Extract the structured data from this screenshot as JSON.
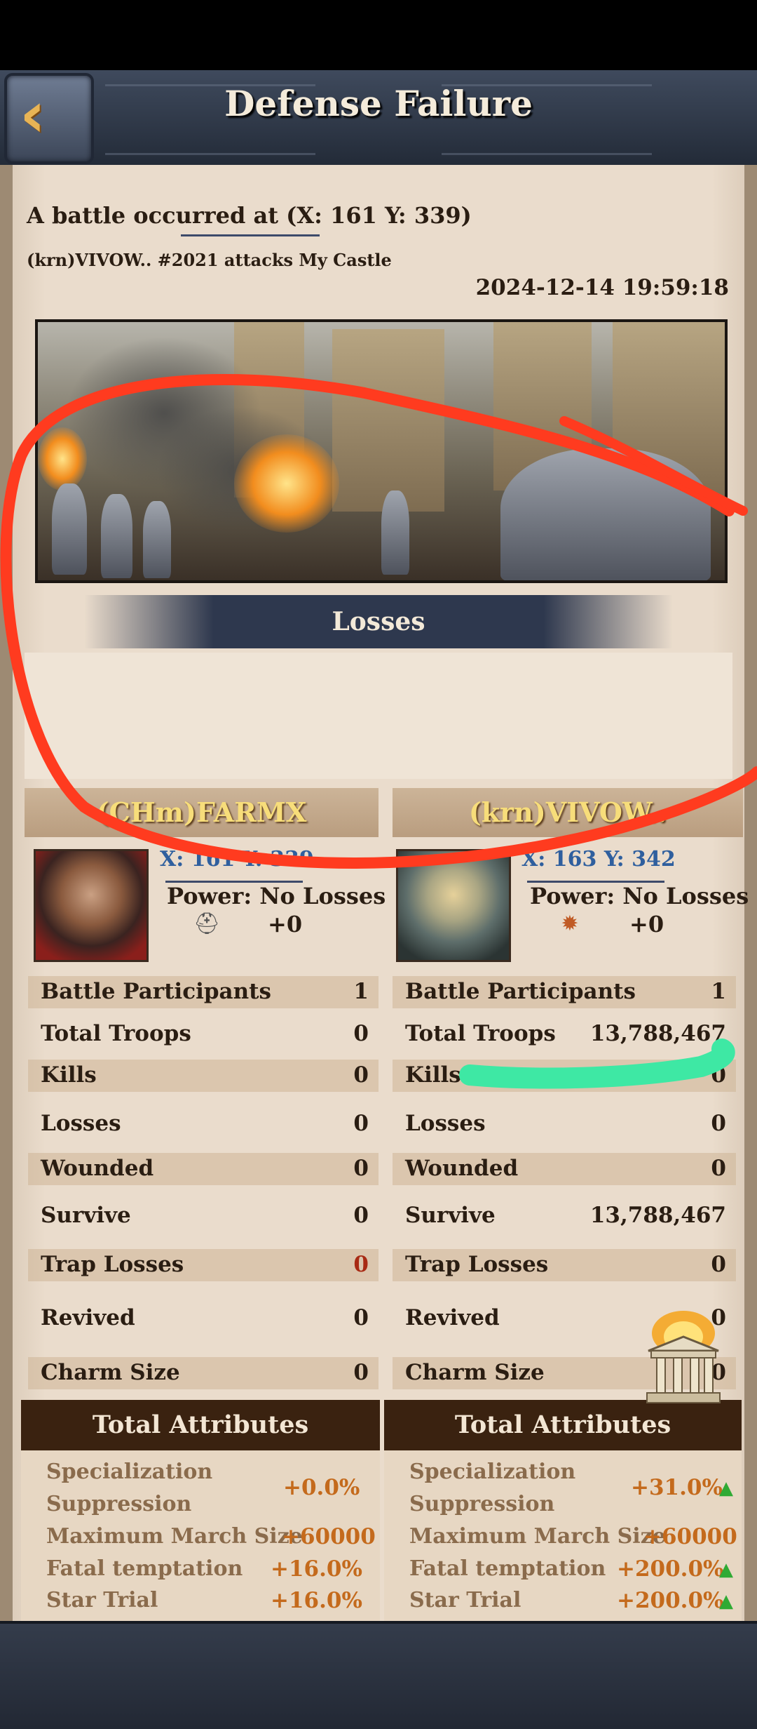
{
  "header": {
    "title": "Defense Failure",
    "back_icon": "chevron-left-icon"
  },
  "battle": {
    "location": "A battle occurred at (X: 161 Y: 339)",
    "attack_line": "(krn)VIVOW.. #2021 attacks My Castle",
    "datetime": "2024-12-14  19:59:18"
  },
  "losses": {
    "label": "Losses"
  },
  "players": {
    "left": {
      "name": "(CHm)FARMX",
      "coords": "X: 161 Y: 339",
      "power": "Power: No Losses",
      "bonus": "+0",
      "stats": [
        {
          "label": "Battle Participants",
          "value": "1"
        },
        {
          "label": "Total Troops",
          "value": "0"
        },
        {
          "label": "Kills",
          "value": "0"
        },
        {
          "label": "Losses",
          "value": "0"
        },
        {
          "label": "Wounded",
          "value": "0"
        },
        {
          "label": "Survive",
          "value": "0"
        },
        {
          "label": "Trap Losses",
          "value": "0"
        },
        {
          "label": "Revived",
          "value": "0"
        },
        {
          "label": "Charm Size",
          "value": "0"
        }
      ],
      "attributes_title": "Total Attributes",
      "attributes": [
        {
          "label": "Specialization Suppression",
          "label_line1": "Specialization",
          "label_line2": "Suppression",
          "value": "+0.0%"
        },
        {
          "label": "Maximum March Size",
          "value": "+60000"
        },
        {
          "label": "Fatal temptation",
          "value": "+16.0%"
        },
        {
          "label": "Star Trial",
          "value": "+16.0%"
        }
      ]
    },
    "right": {
      "name": "(krn)VIVOW..",
      "coords": "X: 163 Y: 342",
      "power": "Power: No Losses",
      "bonus": "+0",
      "stats": [
        {
          "label": "Battle Participants",
          "value": "1"
        },
        {
          "label": "Total Troops",
          "value": "13,788,467"
        },
        {
          "label": "Kills",
          "value": "0"
        },
        {
          "label": "Losses",
          "value": "0"
        },
        {
          "label": "Wounded",
          "value": "0"
        },
        {
          "label": "Survive",
          "value": "13,788,467"
        },
        {
          "label": "Trap Losses",
          "value": "0"
        },
        {
          "label": "Revived",
          "value": "0"
        },
        {
          "label": "Charm Size",
          "value": "0"
        }
      ],
      "attributes_title": "Total Attributes",
      "attributes": [
        {
          "label": "Specialization Suppression",
          "label_line1": "Specialization",
          "label_line2": "Suppression",
          "value": "+31.0%"
        },
        {
          "label": "Maximum March Size",
          "value": "+60000"
        },
        {
          "label": "Fatal temptation",
          "value": "+200.0%"
        },
        {
          "label": "Star Trial",
          "value": "+200.0%"
        }
      ]
    }
  },
  "nav": {
    "icons": [
      "star-icon",
      "share-icon",
      "zoom-in-icon",
      "trash-icon"
    ]
  },
  "colors": {
    "accent": "#d89a3b",
    "header": "#2e384e",
    "panel": "#eadccc",
    "annotation_red": "#ff3b1f",
    "highlight_green": "#3ee8a4"
  }
}
